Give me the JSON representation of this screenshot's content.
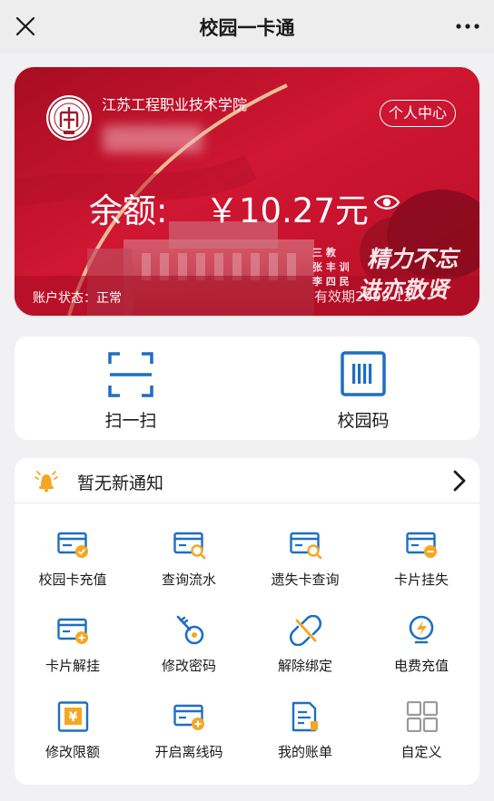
{
  "nav": {
    "title": "校园一卡通"
  },
  "card": {
    "school_name": "江苏工程职业技术学院",
    "profile_button": "个人中心",
    "balance_label": "余额:",
    "balance_value": "￥10.27元",
    "status_text": "账户状态：正常",
    "expiry_text": "有效期2099-12-",
    "calligraphy": [
      "精力不忘",
      "进亦敬贤"
    ],
    "colors": {
      "card_red": "#c6102a",
      "dark_red": "#8e0a1d"
    }
  },
  "quick_actions": [
    {
      "label": "扫一扫",
      "icon": "scan-icon"
    },
    {
      "label": "校园码",
      "icon": "barcode-icon"
    }
  ],
  "notice": {
    "text": "暂无新通知",
    "icon": "bell-icon"
  },
  "services": [
    {
      "label": "校园卡充值",
      "icon": "card-recharge-icon"
    },
    {
      "label": "查询流水",
      "icon": "card-search-icon"
    },
    {
      "label": "遗失卡查询",
      "icon": "lost-card-search-icon"
    },
    {
      "label": "卡片挂失",
      "icon": "card-freeze-icon"
    },
    {
      "label": "卡片解挂",
      "icon": "card-unfreeze-icon"
    },
    {
      "label": "修改密码",
      "icon": "key-icon"
    },
    {
      "label": "解除绑定",
      "icon": "unlink-icon"
    },
    {
      "label": "电费充值",
      "icon": "electricity-icon"
    },
    {
      "label": "修改限额",
      "icon": "limit-icon"
    },
    {
      "label": "开启离线码",
      "icon": "offline-code-icon"
    },
    {
      "label": "我的账单",
      "icon": "bill-icon"
    },
    {
      "label": "自定义",
      "icon": "grid-icon"
    }
  ],
  "theme": {
    "accent_blue": "#1d6fc2",
    "accent_orange": "#f5a623",
    "gray_icon": "#9a9a9a"
  }
}
